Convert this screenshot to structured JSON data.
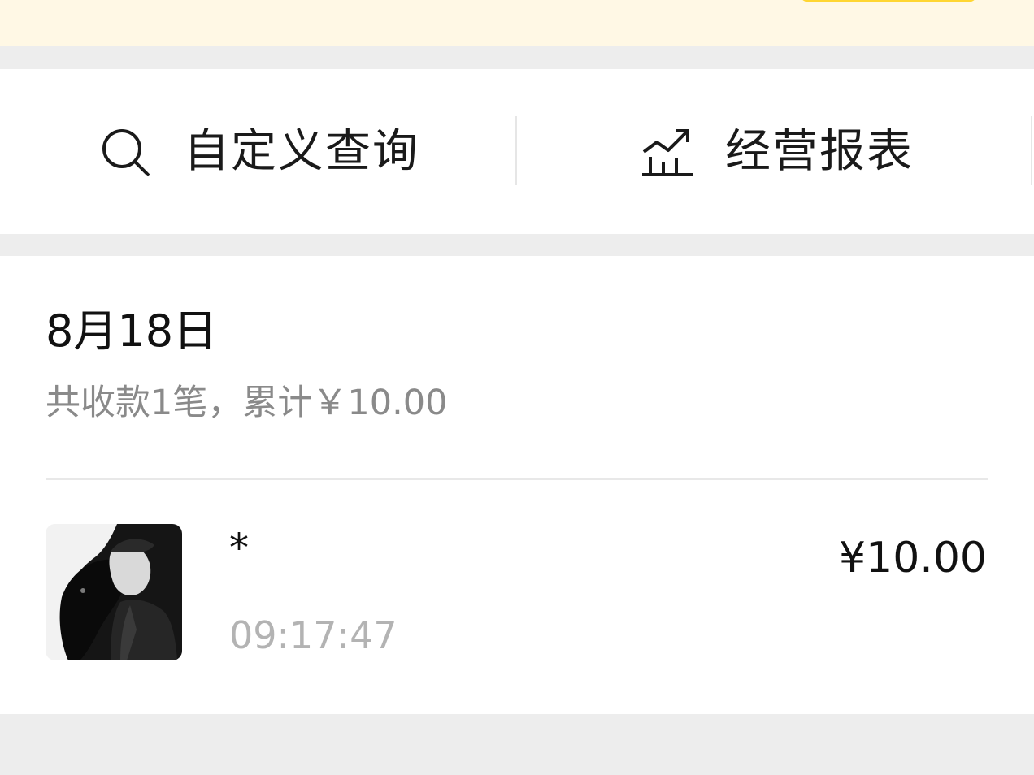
{
  "actions": {
    "custom_query": {
      "label": "自定义查询",
      "icon": "search-icon"
    },
    "business_report": {
      "label": "经营报表",
      "icon": "growth-chart-icon"
    }
  },
  "day": {
    "date": "8月18日",
    "summary": "共收款1笔，累计￥10.00",
    "transactions": [
      {
        "payer": "*",
        "time": "09:17:47",
        "amount": "¥10.00",
        "avatar": "payer-avatar"
      }
    ]
  },
  "colors": {
    "banner_bg": "#fff8e5",
    "banner_button": "#ffd632",
    "page_bg": "#ededed"
  }
}
